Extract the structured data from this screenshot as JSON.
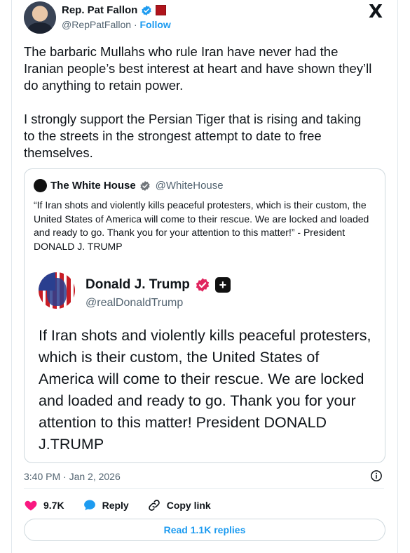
{
  "post": {
    "author_name": "Rep. Pat Fallon",
    "author_handle": "@RepPatFallon",
    "separator": "·",
    "follow_label": "Follow",
    "x_logo": "X",
    "text_paragraphs": [
      "The barbaric Mullahs who rule Iran have never had the Iranian people’s best interest at heart and have shown they’ll do anything to retain power.",
      "I strongly support the Persian Tiger that is rising and taking to the streets in the strongest attempt to date to free themselves."
    ],
    "timestamp": "3:40 PM · Jan 2, 2026"
  },
  "quote": {
    "author_name": "The White House",
    "author_handle": "@WhiteHouse",
    "text": "“If Iran shots and violently kills peaceful protesters, which is their custom, the United States of America will come to their rescue. We are locked and loaded and ready to go. Thank you for your attention to this matter!” - President DONALD J. TRUMP",
    "embed": {
      "author_name": "Donald J. Trump",
      "author_handle": "@realDonaldTrump",
      "text": "If Iran shots and violently kills peaceful protesters, which is their custom, the United States of America will come to their rescue. We are locked and loaded and ready to go. Thank you for your attention to this matter! President DONALD J.TRUMP"
    }
  },
  "actions": {
    "like_count": "9.7K",
    "reply_label": "Reply",
    "copy_link_label": "Copy link",
    "read_replies_label": "Read 1.1K replies"
  },
  "icons": {
    "verified": "verified-badge-icon",
    "like": "heart-icon",
    "reply": "speech-bubble-icon",
    "copy": "link-icon",
    "info": "info-icon"
  },
  "colors": {
    "accent": "#1d9bf0",
    "like": "#f91880",
    "verified_red": "#e0245e",
    "text": "#0f1419",
    "muted": "#536471"
  }
}
